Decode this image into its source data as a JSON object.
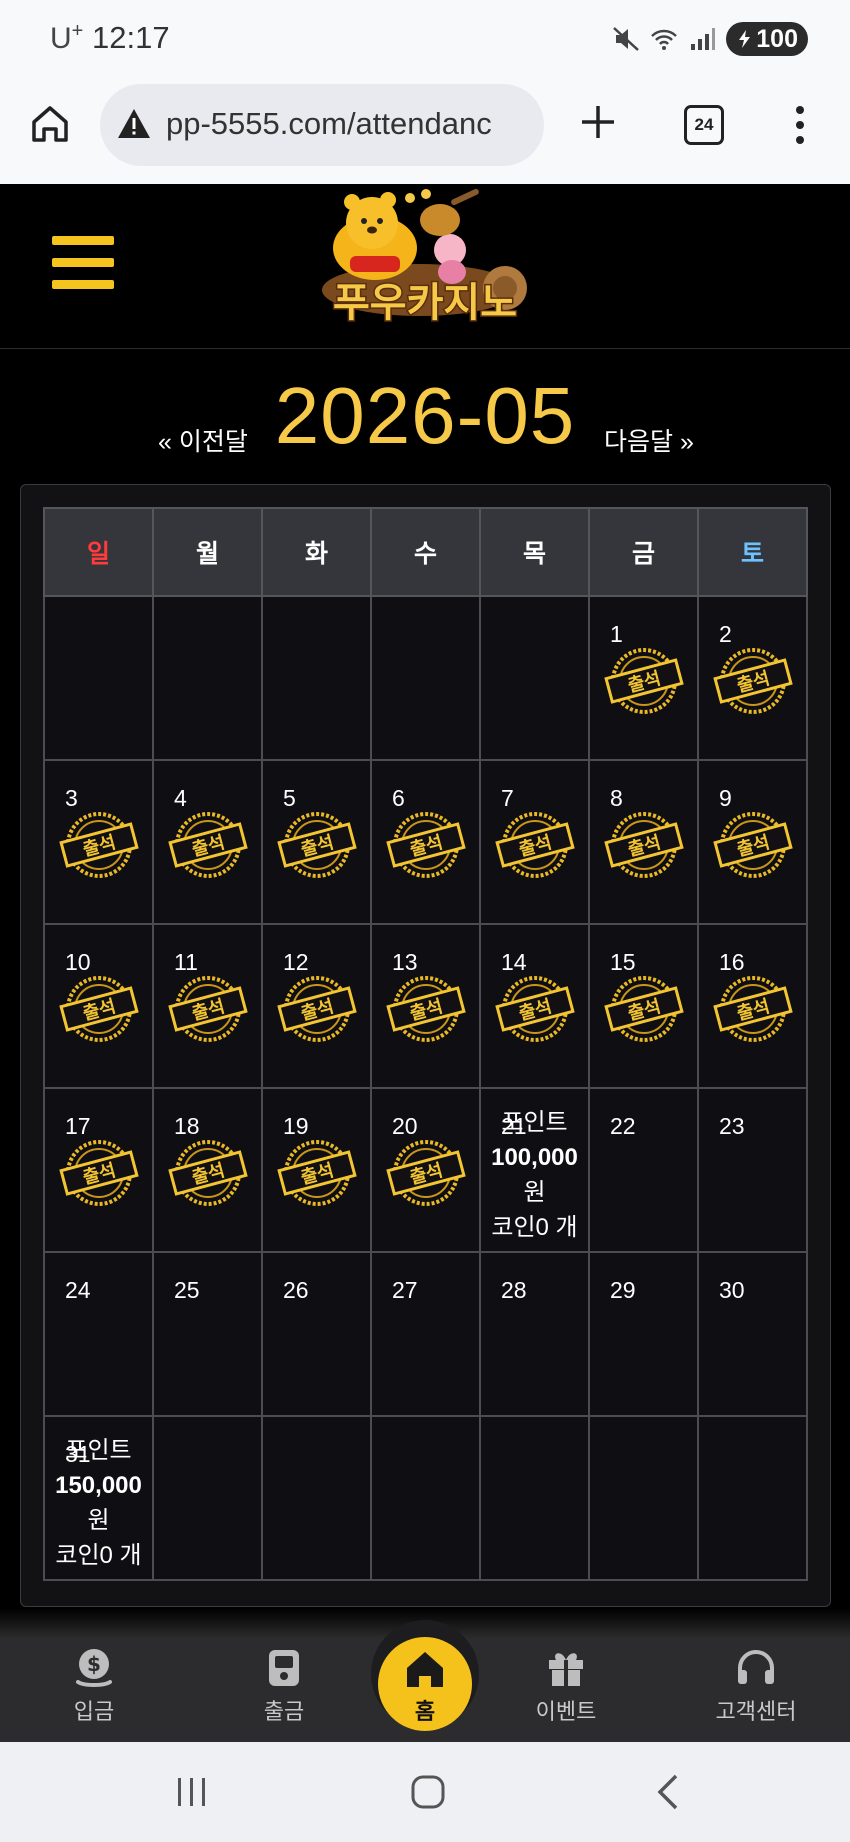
{
  "status_bar": {
    "carrier": "U",
    "carrier_sup": "+",
    "time": "12:17",
    "battery": "100",
    "icons": [
      "mute-icon",
      "wifi-icon",
      "signal-icon",
      "battery-icon"
    ]
  },
  "browser": {
    "url": "pp-5555.com/attendanc",
    "tab_count": "24",
    "icons": [
      "home-icon",
      "warning-icon",
      "plus-icon",
      "more-vert-icon"
    ]
  },
  "site": {
    "logo_text": "푸우카지노",
    "menu_icon": "hamburger-icon"
  },
  "month_nav": {
    "prev": "« 이전달",
    "title": "2026-05",
    "next": "다음달 »"
  },
  "calendar": {
    "weekdays": [
      "일",
      "월",
      "화",
      "수",
      "목",
      "금",
      "토"
    ],
    "stamp_label": "출석",
    "weeks": [
      [
        {
          "day": "",
          "stamp": false
        },
        {
          "day": "",
          "stamp": false
        },
        {
          "day": "",
          "stamp": false
        },
        {
          "day": "",
          "stamp": false
        },
        {
          "day": "",
          "stamp": false
        },
        {
          "day": "1",
          "stamp": true
        },
        {
          "day": "2",
          "stamp": true
        }
      ],
      [
        {
          "day": "3",
          "stamp": true
        },
        {
          "day": "4",
          "stamp": true
        },
        {
          "day": "5",
          "stamp": true
        },
        {
          "day": "6",
          "stamp": true
        },
        {
          "day": "7",
          "stamp": true
        },
        {
          "day": "8",
          "stamp": true
        },
        {
          "day": "9",
          "stamp": true
        }
      ],
      [
        {
          "day": "10",
          "stamp": true
        },
        {
          "day": "11",
          "stamp": true
        },
        {
          "day": "12",
          "stamp": true
        },
        {
          "day": "13",
          "stamp": true
        },
        {
          "day": "14",
          "stamp": true
        },
        {
          "day": "15",
          "stamp": true
        },
        {
          "day": "16",
          "stamp": true
        }
      ],
      [
        {
          "day": "17",
          "stamp": true
        },
        {
          "day": "18",
          "stamp": true
        },
        {
          "day": "19",
          "stamp": true
        },
        {
          "day": "20",
          "stamp": true
        },
        {
          "day": "21",
          "stamp": false,
          "reward": {
            "line1": "포인트",
            "amount": "100,000",
            "unit": "원",
            "coin": "코인0 개"
          }
        },
        {
          "day": "22",
          "stamp": false
        },
        {
          "day": "23",
          "stamp": false
        }
      ],
      [
        {
          "day": "24",
          "stamp": false
        },
        {
          "day": "25",
          "stamp": false
        },
        {
          "day": "26",
          "stamp": false
        },
        {
          "day": "27",
          "stamp": false
        },
        {
          "day": "28",
          "stamp": false
        },
        {
          "day": "29",
          "stamp": false
        },
        {
          "day": "30",
          "stamp": false
        }
      ],
      [
        {
          "day": "31",
          "stamp": false,
          "reward": {
            "line1": "포인트",
            "amount": "150,000",
            "unit": "원",
            "coin": "코인0 개"
          }
        },
        {
          "day": "",
          "stamp": false
        },
        {
          "day": "",
          "stamp": false
        },
        {
          "day": "",
          "stamp": false
        },
        {
          "day": "",
          "stamp": false
        },
        {
          "day": "",
          "stamp": false
        },
        {
          "day": "",
          "stamp": false
        }
      ]
    ]
  },
  "bottom_nav": {
    "items": [
      {
        "label": "입금",
        "icon": "deposit-icon"
      },
      {
        "label": "출금",
        "icon": "withdraw-icon"
      },
      {
        "label": "홈",
        "icon": "home-icon"
      },
      {
        "label": "이벤트",
        "icon": "gift-icon"
      },
      {
        "label": "고객센터",
        "icon": "headset-icon"
      }
    ]
  },
  "colors": {
    "accent": "#f5c21b",
    "sunday": "#ff3b3b",
    "saturday": "#6ec1ff",
    "cell_bg": "#0f0e12"
  }
}
